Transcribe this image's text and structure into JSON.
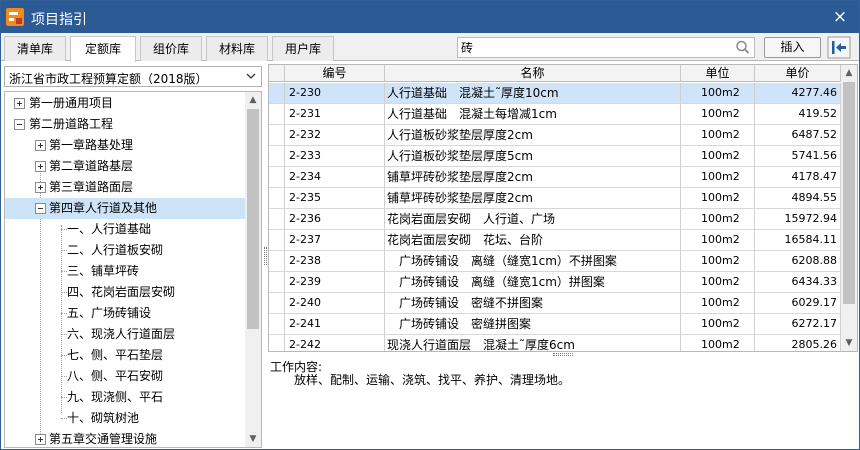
{
  "window": {
    "title": "项目指引",
    "close_glyph": "×"
  },
  "tabs": [
    {
      "label": "清单库",
      "active": false
    },
    {
      "label": "定额库",
      "active": true
    },
    {
      "label": "组价库",
      "active": false
    },
    {
      "label": "材料库",
      "active": false
    },
    {
      "label": "用户库",
      "active": false
    }
  ],
  "search": {
    "value": "砖"
  },
  "toolbar": {
    "insert_label": "插入"
  },
  "library": {
    "selected": "浙江省市政工程预算定额（2018版）"
  },
  "tree": [
    {
      "label": "第一册通用项目",
      "level": 0,
      "expander": "plus"
    },
    {
      "label": "第二册道路工程",
      "level": 0,
      "expander": "minus"
    },
    {
      "label": "第一章路基处理",
      "level": 1,
      "expander": "plus"
    },
    {
      "label": "第二章道路基层",
      "level": 1,
      "expander": "plus"
    },
    {
      "label": "第三章道路面层",
      "level": 1,
      "expander": "plus"
    },
    {
      "label": "第四章人行道及其他",
      "level": 1,
      "expander": "minus",
      "selected": true
    },
    {
      "label": "一、人行道基础",
      "level": 2,
      "expander": "none"
    },
    {
      "label": "二、人行道板安砌",
      "level": 2,
      "expander": "none"
    },
    {
      "label": "三、铺草坪砖",
      "level": 2,
      "expander": "none"
    },
    {
      "label": "四、花岗岩面层安砌",
      "level": 2,
      "expander": "none"
    },
    {
      "label": "五、广场砖铺设",
      "level": 2,
      "expander": "none"
    },
    {
      "label": "六、现浇人行道面层",
      "level": 2,
      "expander": "none"
    },
    {
      "label": "七、侧、平石垫层",
      "level": 2,
      "expander": "none"
    },
    {
      "label": "八、侧、平石安砌",
      "level": 2,
      "expander": "none"
    },
    {
      "label": "九、现浇侧、平石",
      "level": 2,
      "expander": "none"
    },
    {
      "label": "十、砌筑树池",
      "level": 2,
      "expander": "none"
    },
    {
      "label": "第五章交通管理设施",
      "level": 1,
      "expander": "plus"
    }
  ],
  "grid": {
    "columns": [
      "编号",
      "名称",
      "单位",
      "单价"
    ],
    "rows": [
      {
        "code": "2-230",
        "name": "人行道基础　混凝土˜厚度10cm",
        "unit": "100m2",
        "price": "4277.46",
        "selected": true
      },
      {
        "code": "2-231",
        "name": "人行道基础　混凝土每增减1cm",
        "unit": "100m2",
        "price": "419.52"
      },
      {
        "code": "2-232",
        "name": "人行道板砂浆垫层厚度2cm",
        "unit": "100m2",
        "price": "6487.52"
      },
      {
        "code": "2-233",
        "name": "人行道板砂浆垫层厚度5cm",
        "unit": "100m2",
        "price": "5741.56"
      },
      {
        "code": "2-234",
        "name": "铺草坪砖砂浆垫层厚度2cm",
        "unit": "100m2",
        "price": "4178.47"
      },
      {
        "code": "2-235",
        "name": "铺草坪砖砂浆垫层厚度2cm",
        "unit": "100m2",
        "price": "4894.55"
      },
      {
        "code": "2-236",
        "name": "花岗岩面层安砌　人行道、广场",
        "unit": "100m2",
        "price": "15972.94"
      },
      {
        "code": "2-237",
        "name": "花岗岩面层安砌　花坛、台阶",
        "unit": "100m2",
        "price": "16584.11"
      },
      {
        "code": "2-238",
        "name": "　广场砖铺设　离缝（缝宽1cm）不拼图案",
        "unit": "100m2",
        "price": "6208.88"
      },
      {
        "code": "2-239",
        "name": "　广场砖铺设　离缝（缝宽1cm）拼图案",
        "unit": "100m2",
        "price": "6434.33"
      },
      {
        "code": "2-240",
        "name": "　广场砖铺设　密缝不拼图案",
        "unit": "100m2",
        "price": "6029.17"
      },
      {
        "code": "2-241",
        "name": "　广场砖铺设　密缝拼图案",
        "unit": "100m2",
        "price": "6272.17"
      },
      {
        "code": "2-242",
        "name": "现浇人行道面层　混凝土˜厚度6cm",
        "unit": "100m2",
        "price": "2805.26"
      }
    ]
  },
  "work": {
    "title": "工作内容:",
    "text": "放样、配制、运输、浇筑、找平、养护、清理场地。"
  },
  "colors": {
    "titlebar": "#2b5a94",
    "selection": "#cfe4f9",
    "app_icon": "#f28a1e"
  },
  "icons": {
    "app": "app-logo-icon",
    "search": "search-icon",
    "exit": "exit-panel-icon",
    "dropdown": "chevron-down-icon"
  }
}
